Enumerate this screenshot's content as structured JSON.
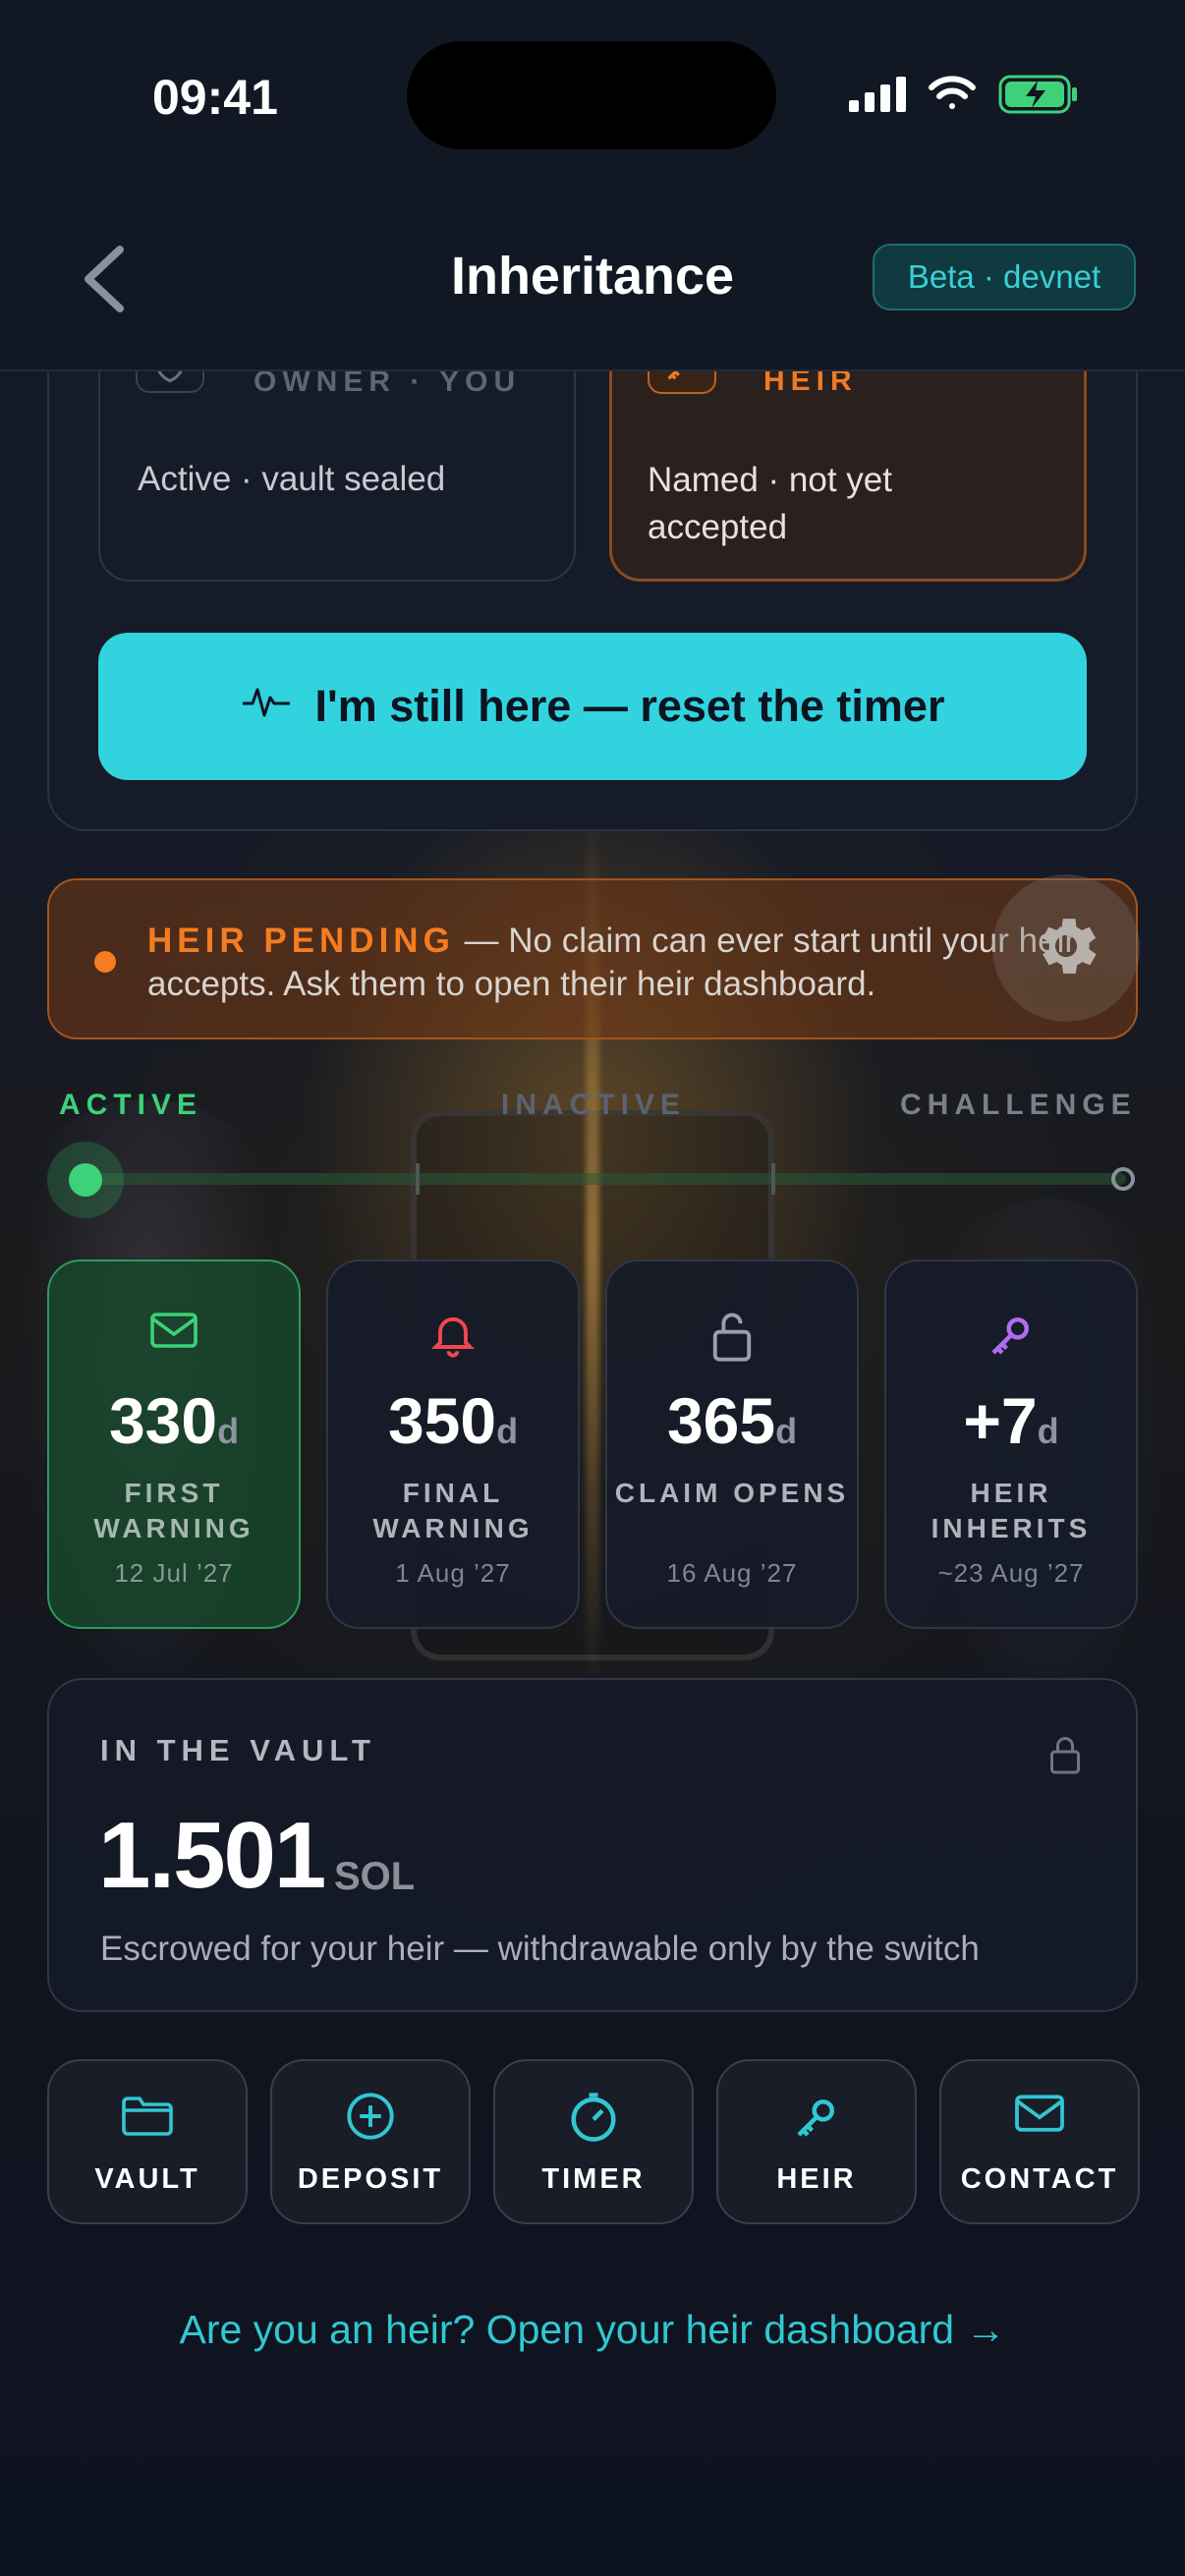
{
  "status_bar": {
    "time": "09:41"
  },
  "nav": {
    "title": "Inheritance",
    "badge": "Beta · devnet"
  },
  "roles": {
    "owner": {
      "label": "OWNER · YOU",
      "status": "Active · vault sealed",
      "icon": "shield-check-icon"
    },
    "heir": {
      "label": "HEIR",
      "status": "Named · not yet accepted",
      "icon": "key-icon"
    }
  },
  "reset_button": {
    "label": "I'm still here — reset the timer",
    "icon": "heartbeat-icon"
  },
  "pending": {
    "title": "HEIR PENDING",
    "separator": "—",
    "message": "No claim can ever start until your heir accepts. Ask them to open their heir dashboard."
  },
  "phases": {
    "active": "ACTIVE",
    "inactive": "INACTIVE",
    "challenge": "CHALLENGE",
    "current": "active"
  },
  "milestones": [
    {
      "value": "330",
      "unit": "d",
      "label": "FIRST WARNING",
      "date": "12 Jul ’27",
      "icon": "mail-icon",
      "color": "#3dd17a",
      "active": true
    },
    {
      "value": "350",
      "unit": "d",
      "label": "FINAL WARNING",
      "date": "1 Aug ’27",
      "icon": "bell-icon",
      "color": "#f0474f",
      "active": false
    },
    {
      "value": "365",
      "unit": "d",
      "label": "CLAIM OPENS",
      "date": "16 Aug ’27",
      "icon": "unlock-icon",
      "color": "#9aa0ab",
      "active": false
    },
    {
      "value": "+7",
      "unit": "d",
      "label": "HEIR INHERITS",
      "date": "~23 Aug ’27",
      "icon": "key-icon",
      "color": "#b06cf0",
      "active": false
    }
  ],
  "vault": {
    "label": "IN THE VAULT",
    "amount": "1.501",
    "unit": "SOL",
    "description": "Escrowed for your heir — withdrawable only by the switch"
  },
  "actions": [
    {
      "label": "VAULT",
      "icon": "folder-icon"
    },
    {
      "label": "DEPOSIT",
      "icon": "plus-circle-icon"
    },
    {
      "label": "TIMER",
      "icon": "timer-icon"
    },
    {
      "label": "HEIR",
      "icon": "key-icon"
    },
    {
      "label": "CONTACT",
      "icon": "mail-icon"
    }
  ],
  "heir_link": "Are you an heir? Open your heir dashboard →",
  "colors": {
    "accent": "#31d3de",
    "active_green": "#3dd17a",
    "warning_orange": "#f47d22"
  }
}
